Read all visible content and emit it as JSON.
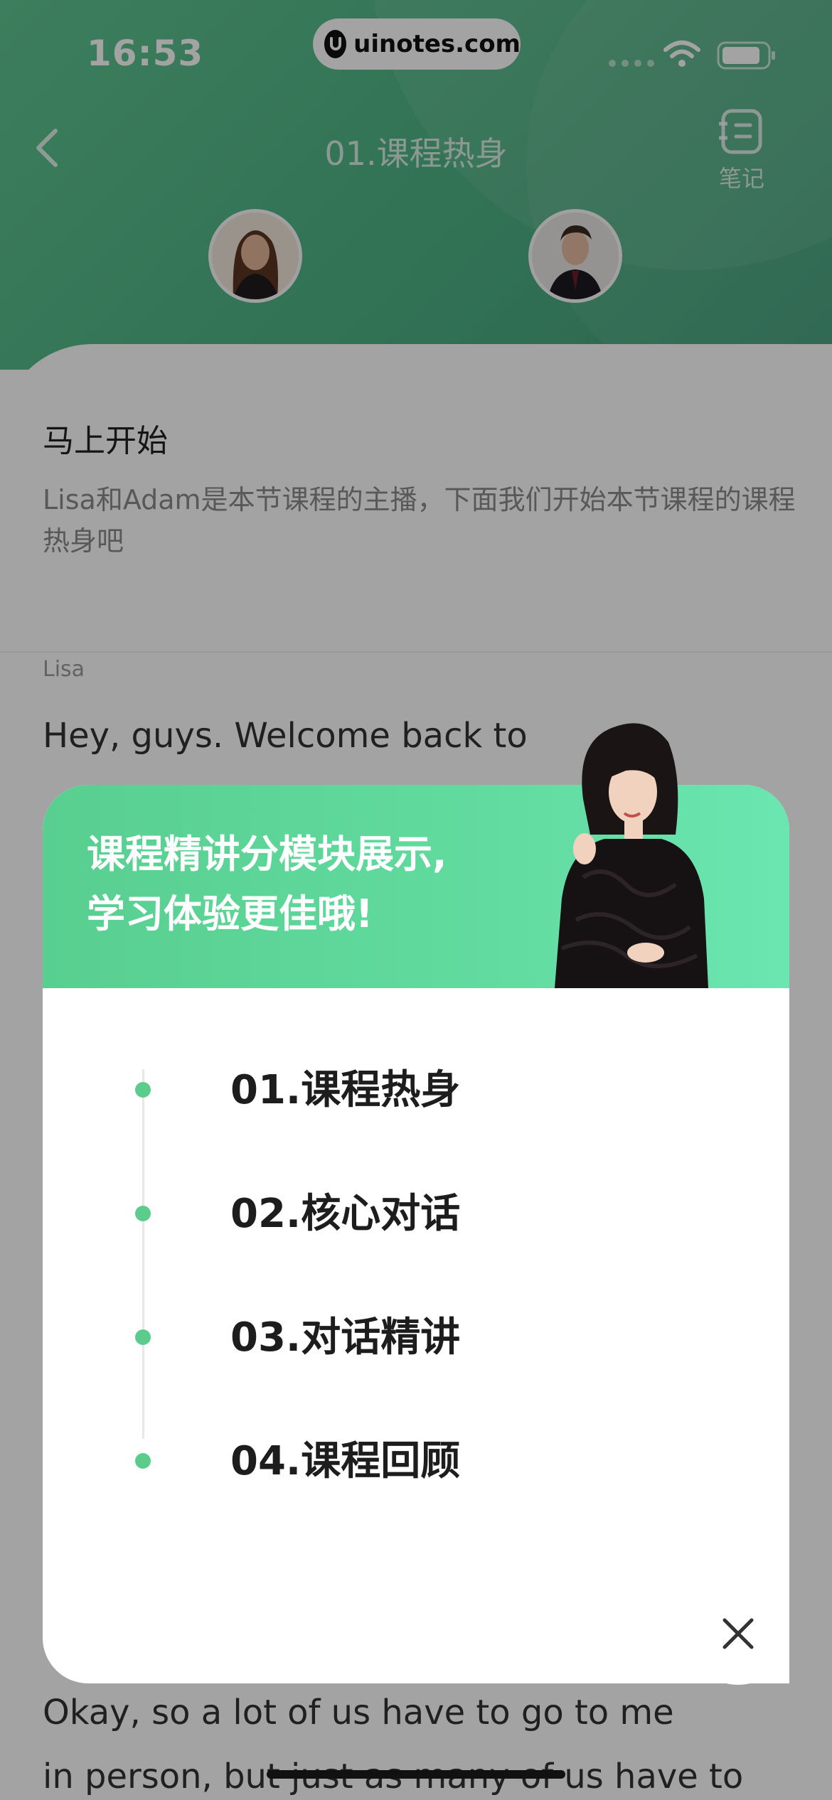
{
  "status_bar": {
    "time": "16:53",
    "url": "uinotes.com"
  },
  "nav": {
    "title": "01.课程热身",
    "notes_label": "笔记"
  },
  "content": {
    "section_title": "马上开始",
    "section_desc": "Lisa和Adam是本节课程的主播，下面我们开始本节课程的课程热身吧",
    "speaker": "Lisa",
    "transcript_top": "Hey, guys. Welcome back to",
    "transcript_bottom": "Okay, so a lot of us have to go to meetings in person, but just as many of us have to go"
  },
  "modal": {
    "heading_line1": "课程精讲分模块展示,",
    "heading_line2": "学习体验更佳哦!",
    "modules": [
      "01.课程热身",
      "02.核心对话",
      "03.对话精讲",
      "04.课程回顾"
    ]
  },
  "colors": {
    "accent_green": "#5ccc8d",
    "header_green": "#4fb385"
  }
}
